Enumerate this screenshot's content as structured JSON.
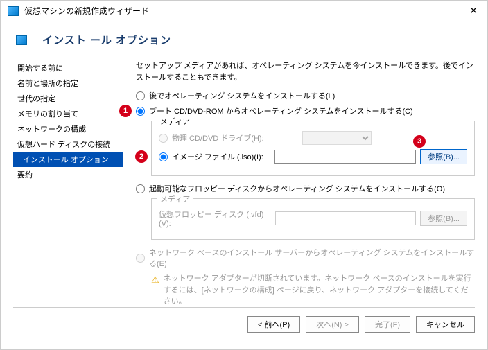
{
  "window": {
    "title": "仮想マシンの新規作成ウィザード"
  },
  "header": {
    "title": "インスト ール オプション"
  },
  "sidebar": {
    "items": [
      {
        "label": "開始する前に"
      },
      {
        "label": "名前と場所の指定"
      },
      {
        "label": "世代の指定"
      },
      {
        "label": "メモリの割り当て"
      },
      {
        "label": "ネットワークの構成"
      },
      {
        "label": "仮想ハード ディスクの接続"
      },
      {
        "label": "インストール オプション"
      },
      {
        "label": "要約"
      }
    ]
  },
  "content": {
    "intro": "セットアップ メディアがあれば、オペレーティング システムを今インストールできます。後でインストールすることもできます。",
    "opt_later": "後でオペレーティング システムをインストールする(L)",
    "opt_cd": "ブート CD/DVD-ROM からオペレーティング システムをインストールする(C)",
    "media": {
      "legend": "メディア",
      "physical": "物理 CD/DVD ドライブ(H):",
      "image": "イメージ ファイル (.iso)(I):",
      "iso_value": "",
      "browse": "参照(B)..."
    },
    "opt_floppy": "起動可能なフロッピー ディスクからオペレーティング システムをインストールする(O)",
    "floppy": {
      "legend": "メディア",
      "vfd": "仮想フロッピー ディスク (.vfd)(V):",
      "vfd_value": "",
      "browse": "参照(B)..."
    },
    "opt_network": "ネットワーク ベースのインストール サーバーからオペレーティング システムをインストールする(E)",
    "warn": "ネットワーク アダプターが切断されています。ネットワーク ベースのインストールを実行するには、[ネットワークの構成] ページに戻り、ネットワーク アダプターを接続してください。"
  },
  "footer": {
    "prev": "< 前へ(P)",
    "next": "次へ(N) >",
    "finish": "完了(F)",
    "cancel": "キャンセル"
  },
  "badges": {
    "b1": "1",
    "b2": "2",
    "b3": "3"
  }
}
